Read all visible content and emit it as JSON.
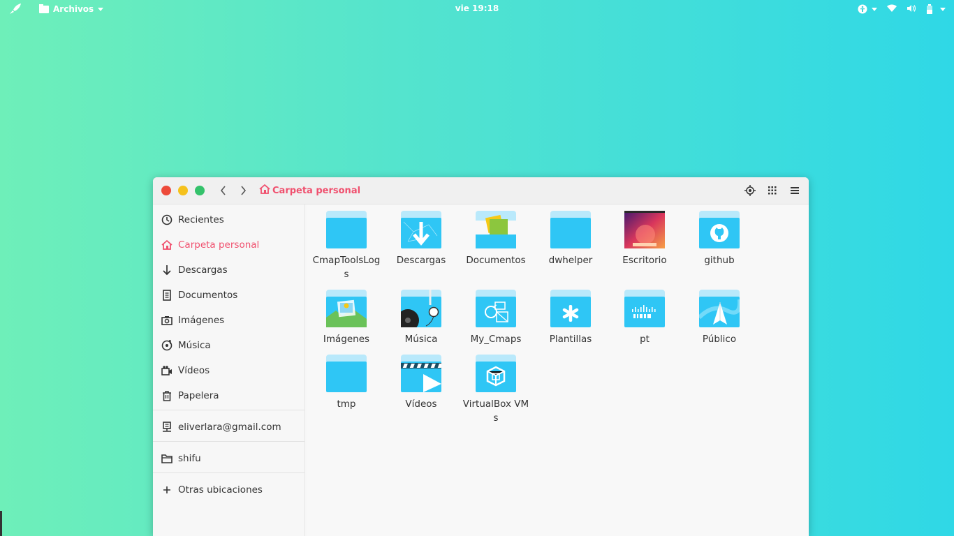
{
  "topbar": {
    "app_menu_label": "Archivos",
    "clock": "vie 19:18"
  },
  "window": {
    "path_label": "Carpeta personal"
  },
  "sidebar": {
    "items": [
      {
        "label": "Recientes",
        "icon": "clock-icon"
      },
      {
        "label": "Carpeta personal",
        "icon": "home-icon"
      },
      {
        "label": "Descargas",
        "icon": "download-icon"
      },
      {
        "label": "Documentos",
        "icon": "document-icon"
      },
      {
        "label": "Imágenes",
        "icon": "camera-icon"
      },
      {
        "label": "Música",
        "icon": "music-icon"
      },
      {
        "label": "Vídeos",
        "icon": "video-icon"
      },
      {
        "label": "Papelera",
        "icon": "trash-icon"
      },
      {
        "label": "eliverlara@gmail.com",
        "icon": "network-drive-icon"
      },
      {
        "label": "shifu",
        "icon": "folder-icon"
      },
      {
        "label": "Otras ubicaciones",
        "icon": "plus-icon"
      }
    ]
  },
  "files": [
    {
      "label": "CmapToolsLogs",
      "icon": "folder-icon"
    },
    {
      "label": "Descargas",
      "icon": "download-folder-icon"
    },
    {
      "label": "Documentos",
      "icon": "documents-folder-icon"
    },
    {
      "label": "dwhelper",
      "icon": "folder-icon"
    },
    {
      "label": "Escritorio",
      "icon": "desktop-folder-icon"
    },
    {
      "label": "github",
      "icon": "github-folder-icon"
    },
    {
      "label": "Imágenes",
      "icon": "pictures-folder-icon"
    },
    {
      "label": "Música",
      "icon": "music-folder-icon"
    },
    {
      "label": "My_Cmaps",
      "icon": "cmaps-folder-icon"
    },
    {
      "label": "Plantillas",
      "icon": "templates-folder-icon"
    },
    {
      "label": "pt",
      "icon": "cisco-folder-icon"
    },
    {
      "label": "Público",
      "icon": "public-folder-icon"
    },
    {
      "label": "tmp",
      "icon": "folder-icon"
    },
    {
      "label": "Vídeos",
      "icon": "videos-folder-icon"
    },
    {
      "label": "VirtualBox VMs",
      "icon": "virtualbox-folder-icon"
    }
  ],
  "colors": {
    "accent": "#f0506e",
    "folder": "#2fc6f5"
  }
}
